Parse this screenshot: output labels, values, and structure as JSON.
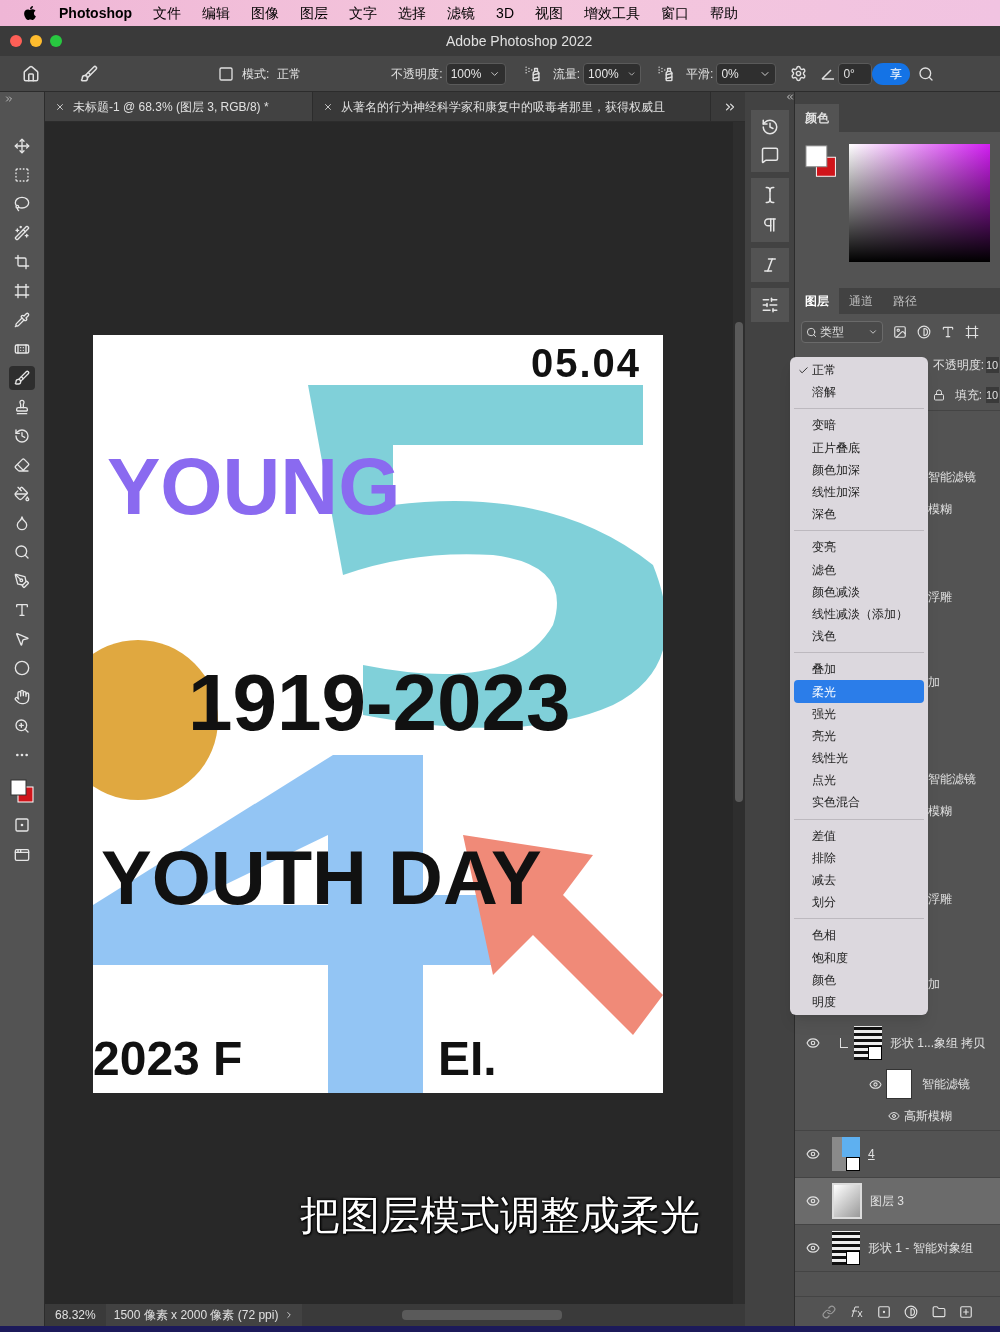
{
  "menu_bar": {
    "app": "Photoshop",
    "items": [
      "文件",
      "编辑",
      "图像",
      "图层",
      "文字",
      "选择",
      "滤镜",
      "3D",
      "视图",
      "增效工具",
      "窗口",
      "帮助"
    ]
  },
  "window": {
    "title": "Adobe Photoshop 2022"
  },
  "options_bar": {
    "mode_label": "模式:",
    "mode_value": "正常",
    "opacity_label": "不透明度:",
    "opacity_value": "100%",
    "flow_label": "流量:",
    "flow_value": "100%",
    "smoothing_label": "平滑:",
    "smoothing_value": "0%",
    "angle_value": "0°",
    "share_button": "享"
  },
  "doc_tabs": [
    {
      "label": "未标题-1 @ 68.3% (图层 3, RGB/8) *",
      "selected": true
    },
    {
      "label": "从著名的行为神经科学家和康复中的吸毒者那里，获得权威且",
      "selected": false
    }
  ],
  "toolbar": {
    "tools": [
      {
        "selected": false
      },
      {
        "selected": false
      },
      {
        "selected": false
      },
      {
        "selected": false
      },
      {
        "selected": false
      },
      {
        "selected": false
      },
      {
        "selected": false
      },
      {
        "selected": false
      },
      {
        "selected": true
      },
      {
        "selected": false
      },
      {
        "selected": false
      },
      {
        "selected": false
      },
      {
        "selected": false
      },
      {
        "selected": false
      },
      {
        "selected": false
      },
      {
        "selected": false
      },
      {
        "selected": false
      },
      {
        "selected": false
      },
      {
        "selected": false
      },
      {
        "selected": false
      },
      {
        "selected": false
      },
      {
        "selected": false
      }
    ]
  },
  "poster": {
    "date": "05.04",
    "headline": "YOUNG",
    "lines": [
      "1919-2023",
      "YOUTH DAY",
      "2023 F",
      "EI."
    ]
  },
  "color_panel": {
    "title": "颜色"
  },
  "layers_panel": {
    "tabs": [
      {
        "label": "图层",
        "selected": true
      },
      {
        "label": "通道",
        "selected": false
      },
      {
        "label": "路径",
        "selected": false
      }
    ],
    "filter": "类型",
    "opacity_label": "不透明度:",
    "opacity_value": "10",
    "fill_label": "填充:",
    "fill_value": "10",
    "hidden_fragments": [
      [
        "智能滤镜",
        "模糊",
        "浮雕",
        "加"
      ],
      [
        "智能滤镜",
        "模糊",
        "浮雕",
        "加"
      ]
    ],
    "layers": [
      {
        "name": "形状 1...象组 拷贝",
        "kind": "smart",
        "clipped": true,
        "selected": false,
        "filters": {
          "title": "智能滤镜",
          "items": [
            "高斯模糊"
          ]
        }
      },
      {
        "name": "4",
        "kind": "shape",
        "clipped": false,
        "selected": false
      },
      {
        "name": "图层 3",
        "kind": "gradient",
        "clipped": false,
        "selected": true
      },
      {
        "name": "形状 1 - 智能对象组",
        "kind": "smart",
        "clipped": false,
        "selected": false
      }
    ]
  },
  "blend_menu": {
    "groups": [
      [
        {
          "label": "正常",
          "checked": true,
          "selected": false
        },
        {
          "label": "溶解",
          "checked": false,
          "selected": false
        }
      ],
      [
        {
          "label": "变暗",
          "checked": false,
          "selected": false
        },
        {
          "label": "正片叠底",
          "checked": false,
          "selected": false
        },
        {
          "label": "颜色加深",
          "checked": false,
          "selected": false
        },
        {
          "label": "线性加深",
          "checked": false,
          "selected": false
        },
        {
          "label": "深色",
          "checked": false,
          "selected": false
        }
      ],
      [
        {
          "label": "变亮",
          "checked": false,
          "selected": false
        },
        {
          "label": "滤色",
          "checked": false,
          "selected": false
        },
        {
          "label": "颜色减淡",
          "checked": false,
          "selected": false
        },
        {
          "label": "线性减淡（添加）",
          "checked": false,
          "selected": false
        },
        {
          "label": "浅色",
          "checked": false,
          "selected": false
        }
      ],
      [
        {
          "label": "叠加",
          "checked": false,
          "selected": false
        },
        {
          "label": "柔光",
          "checked": false,
          "selected": true
        },
        {
          "label": "强光",
          "checked": false,
          "selected": false
        },
        {
          "label": "亮光",
          "checked": false,
          "selected": false
        },
        {
          "label": "线性光",
          "checked": false,
          "selected": false
        },
        {
          "label": "点光",
          "checked": false,
          "selected": false
        },
        {
          "label": "实色混合",
          "checked": false,
          "selected": false
        }
      ],
      [
        {
          "label": "差值",
          "checked": false,
          "selected": false
        },
        {
          "label": "排除",
          "checked": false,
          "selected": false
        },
        {
          "label": "减去",
          "checked": false,
          "selected": false
        },
        {
          "label": "划分",
          "checked": false,
          "selected": false
        }
      ],
      [
        {
          "label": "色相",
          "checked": false,
          "selected": false
        },
        {
          "label": "饱和度",
          "checked": false,
          "selected": false
        },
        {
          "label": "颜色",
          "checked": false,
          "selected": false
        },
        {
          "label": "明度",
          "checked": false,
          "selected": false
        }
      ]
    ]
  },
  "status_bar": {
    "zoom": "68.32%",
    "doc_info": "1500 像素 x 2000 像素 (72 ppi)"
  },
  "caption": "把图层模式调整成柔光"
}
